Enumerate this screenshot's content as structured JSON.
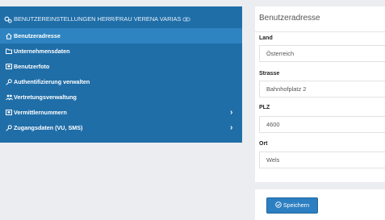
{
  "sidebar": {
    "header": "BENUTZEREINSTELLUNGEN HERR/FRAU VERENA VARIAS",
    "items": [
      {
        "label": "Benutzeradresse",
        "icon": "home-icon",
        "active": true
      },
      {
        "label": "Unternehmensdaten",
        "icon": "folder-icon"
      },
      {
        "label": "Benutzerfoto",
        "icon": "id-card-icon"
      },
      {
        "label": "Authentifizierung verwalten",
        "icon": "key-icon"
      },
      {
        "label": "Vertretungsverwaltung",
        "icon": "users-icon"
      },
      {
        "label": "Vermittlernummern",
        "icon": "id-card-icon",
        "chevron": "›"
      },
      {
        "label": "Zugangsdaten (VU, SMS)",
        "icon": "key-icon",
        "chevron": "›"
      }
    ]
  },
  "form": {
    "title": "Benutzeradresse",
    "fields": [
      {
        "label": "Land",
        "value": "Österreich"
      },
      {
        "label": "Strasse",
        "value": "Bahnhofplatz 2"
      },
      {
        "label": "PLZ",
        "value": "4600"
      },
      {
        "label": "Ort",
        "value": "Wels"
      }
    ],
    "save_label": "Speichern"
  },
  "colors": {
    "sidebar": "#1f6ea8",
    "sidebar_active": "#2e84c1",
    "button": "#2c7fc1",
    "background": "#ecedf0"
  }
}
